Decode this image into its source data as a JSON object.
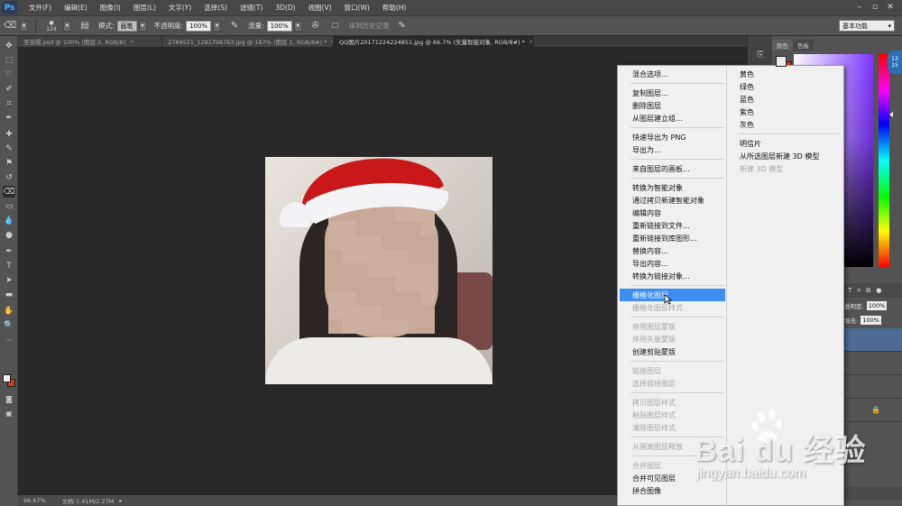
{
  "app": {
    "logo": "Ps"
  },
  "menu": [
    "文件(F)",
    "编辑(E)",
    "图像(I)",
    "图层(L)",
    "文字(Y)",
    "选择(S)",
    "滤镜(T)",
    "3D(D)",
    "视图(V)",
    "窗口(W)",
    "帮助(H)"
  ],
  "options": {
    "brush_size": "124",
    "mode_label": "模式:",
    "mode_value": "画笔",
    "opacity_label": "不透明度:",
    "opacity_value": "100%",
    "flow_label": "流量:",
    "flow_value": "100%",
    "history_label": "抹到历史记录",
    "workspace": "基本功能"
  },
  "tabs": [
    {
      "label": "圣诞帽.psd @ 100% (图层 2, RGB/8)",
      "active": false
    },
    {
      "label": "2789521_1291798763.jpg @ 167% (图层 1, RGB/8#) *",
      "active": false
    },
    {
      "label": "QQ图片20171224224851.jpg @ 66.7% (矢量智能对象, RGB/8#) *",
      "active": true
    }
  ],
  "status": {
    "zoom": "66.67%",
    "doc": "文档:1.41M/2.27M"
  },
  "panel": {
    "tabs": [
      "颜色",
      "色板"
    ],
    "opacity_label": "透明度:",
    "opacity_value": "100%",
    "fill_label": "填充:",
    "fill_value": "100%"
  },
  "badge": {
    "top": "13",
    "bottom": "15"
  },
  "context_menu": {
    "left": [
      {
        "label": "混合选项...",
        "disabled": false,
        "sep_after": true
      },
      {
        "label": "复制图层...",
        "disabled": false
      },
      {
        "label": "删除图层",
        "disabled": false
      },
      {
        "label": "从图层建立组...",
        "disabled": false,
        "sep_after": true
      },
      {
        "label": "快速导出为 PNG",
        "disabled": false
      },
      {
        "label": "导出为...",
        "disabled": false,
        "sep_after": true
      },
      {
        "label": "来自图层的画板...",
        "disabled": false,
        "sep_after": true
      },
      {
        "label": "转换为智能对象",
        "disabled": false
      },
      {
        "label": "通过拷贝新建智能对象",
        "disabled": false
      },
      {
        "label": "编辑内容",
        "disabled": false
      },
      {
        "label": "重新链接到文件...",
        "disabled": false
      },
      {
        "label": "重新链接到库图形...",
        "disabled": false
      },
      {
        "label": "替换内容...",
        "disabled": false
      },
      {
        "label": "导出内容...",
        "disabled": false
      },
      {
        "label": "转换为链接对象...",
        "disabled": false,
        "sep_after": true
      },
      {
        "label": "栅格化图层",
        "disabled": false,
        "highlighted": true
      },
      {
        "label": "栅格化图层样式",
        "disabled": true,
        "sep_after": true
      },
      {
        "label": "停用图层蒙版",
        "disabled": true
      },
      {
        "label": "停用矢量蒙版",
        "disabled": true
      },
      {
        "label": "创建剪贴蒙版",
        "disabled": false,
        "sep_after": true
      },
      {
        "label": "链接图层",
        "disabled": true
      },
      {
        "label": "选择链接图层",
        "disabled": true,
        "sep_after": true
      },
      {
        "label": "拷贝图层样式",
        "disabled": true
      },
      {
        "label": "粘贴图层样式",
        "disabled": true
      },
      {
        "label": "清除图层样式",
        "disabled": true,
        "sep_after": true
      },
      {
        "label": "从隔离图层释放",
        "disabled": true,
        "sep_after": true
      },
      {
        "label": "合并图层",
        "disabled": true
      },
      {
        "label": "合并可见图层",
        "disabled": false
      },
      {
        "label": "拼合图像",
        "disabled": false
      }
    ],
    "right": [
      {
        "label": "黄色",
        "disabled": false
      },
      {
        "label": "绿色",
        "disabled": false
      },
      {
        "label": "蓝色",
        "disabled": false
      },
      {
        "label": "紫色",
        "disabled": false
      },
      {
        "label": "灰色",
        "disabled": false,
        "sep_after": true
      },
      {
        "label": "明信片",
        "disabled": false
      },
      {
        "label": "从所选图层新建 3D 模型",
        "disabled": false
      },
      {
        "label": "新建 3D 模型",
        "disabled": true
      }
    ]
  },
  "watermark": {
    "brand": "Bai du 经验",
    "url": "jingyan.baidu.com"
  }
}
